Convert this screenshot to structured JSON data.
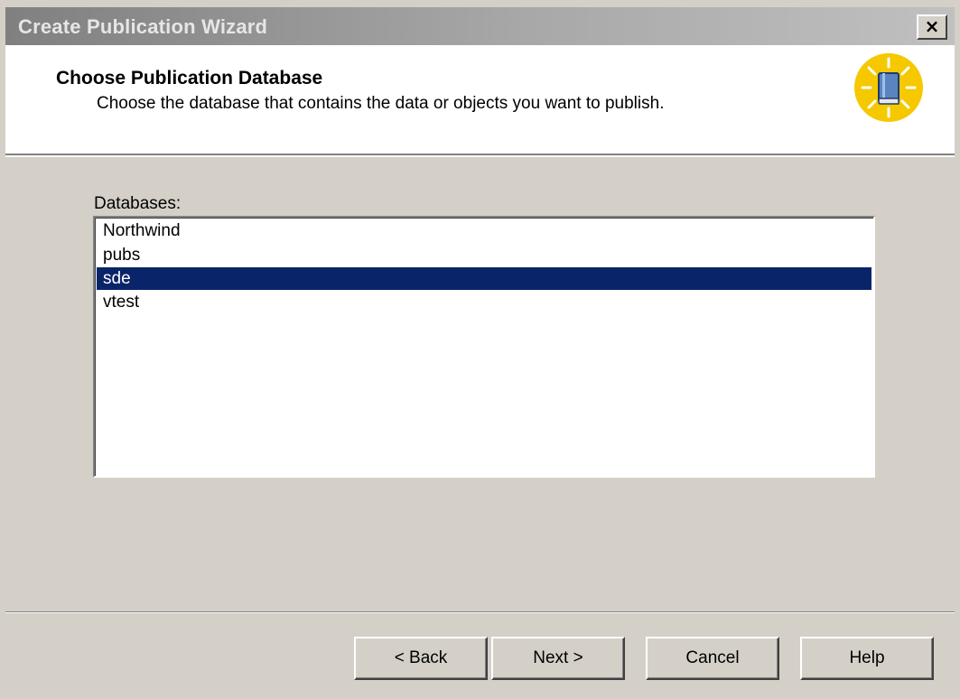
{
  "window": {
    "title": "Create Publication Wizard",
    "close_label": "×"
  },
  "header": {
    "title": "Choose Publication Database",
    "subtitle": "Choose the database that contains the data or objects you want to publish.",
    "icon": "wizard-book-icon"
  },
  "databases": {
    "label": "Databases:",
    "items": [
      {
        "label": "Northwind",
        "selected": false
      },
      {
        "label": "pubs",
        "selected": false
      },
      {
        "label": "sde",
        "selected": true
      },
      {
        "label": "vtest",
        "selected": false
      }
    ]
  },
  "buttons": {
    "back": "< Back",
    "next": "Next >",
    "cancel": "Cancel",
    "help": "Help"
  },
  "colors": {
    "selection": "#0a246a",
    "dialog": "#d4d0c8",
    "icon_yellow": "#f5c800"
  }
}
